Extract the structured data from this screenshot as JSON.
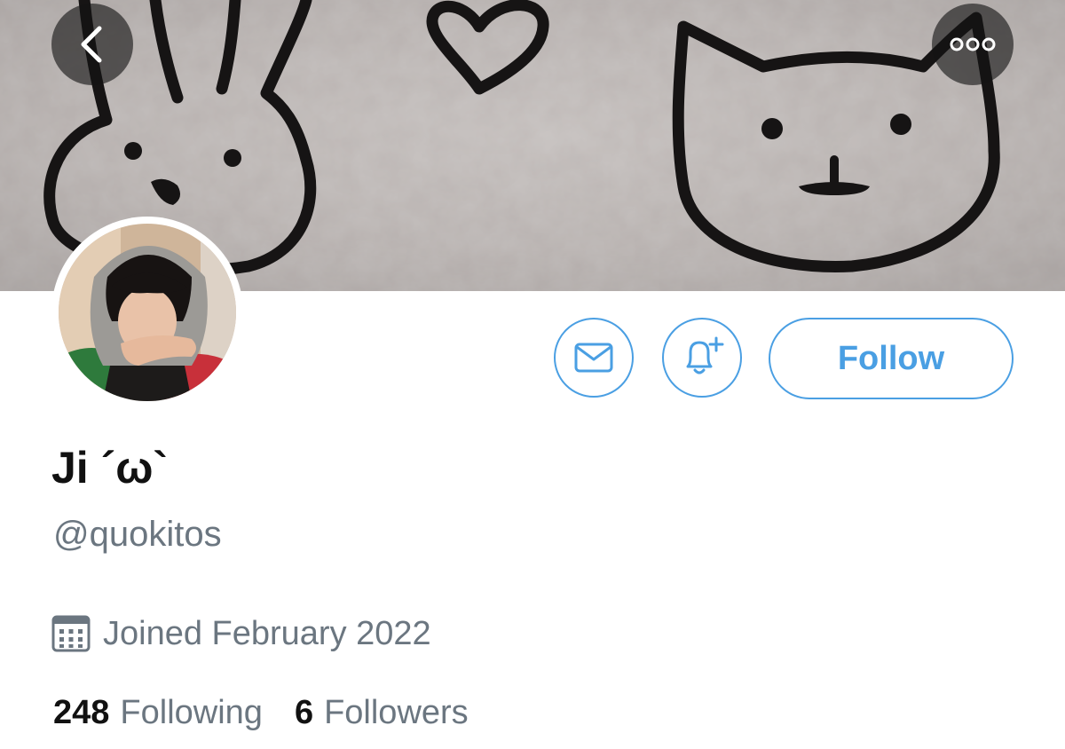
{
  "header": {
    "back_icon": "chevron-left-icon",
    "more_icon": "more-horizontal-icon"
  },
  "actions": {
    "message_icon": "envelope-icon",
    "notify_icon": "bell-plus-icon",
    "follow_label": "Follow"
  },
  "profile": {
    "display_name": "Ji ´ω`",
    "handle": "@quokitos",
    "joined_icon": "calendar-icon",
    "joined": "Joined February 2022"
  },
  "stats": {
    "following_count": "248",
    "following_label": "Following",
    "followers_count": "6",
    "followers_label": "Followers"
  },
  "colors": {
    "accent": "#4a9fe3",
    "secondary_text": "#6b7680",
    "primary_text": "#111111"
  }
}
